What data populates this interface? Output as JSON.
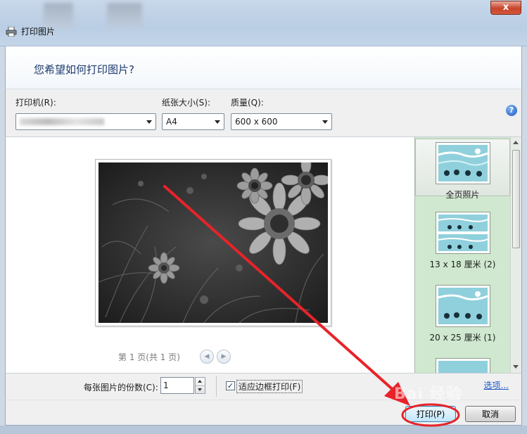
{
  "window": {
    "title": "打印图片",
    "close_glyph": "x"
  },
  "header": {
    "question": "您希望如何打印图片?"
  },
  "options": {
    "printer_label": "打印机(R):",
    "paper_label": "纸张大小(S):",
    "paper_value": "A4",
    "quality_label": "质量(Q):",
    "quality_value": "600 x 600",
    "help_glyph": "?"
  },
  "preview": {
    "page_indicator": "第 1 页(共 1 页)"
  },
  "layouts": [
    {
      "caption": "全页照片",
      "selected": true
    },
    {
      "caption": "13 x 18 厘米 (2)",
      "selected": false
    },
    {
      "caption": "20 x 25 厘米 (1)",
      "selected": false
    }
  ],
  "bottom": {
    "copies_label": "每张图片的份数(C):",
    "copies_value": "1",
    "fit_frame_label": "适应边框打印(F)",
    "fit_frame_checked": true,
    "check_glyph": "✓",
    "options_link": "选项..."
  },
  "footer": {
    "print_button": "打印(P)",
    "cancel_button": "取消"
  },
  "watermark": "Bai 经验",
  "colors": {
    "annotation_red": "#e8232a",
    "layout_pane": "#cfe8cf",
    "header_text": "#1c3a6e"
  }
}
